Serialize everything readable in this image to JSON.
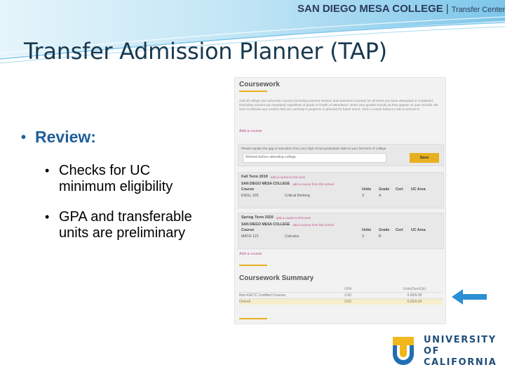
{
  "header": {
    "brand_school": "SAN DIEGO MESA COLLEGE",
    "brand_center": "Transfer Center"
  },
  "slide": {
    "title": "Transfer Admission Planner (TAP)",
    "bullet_main": "Review:",
    "sub_bullets": [
      "Checks for UC minimum eligibility",
      "GPA and transferable units are preliminary"
    ]
  },
  "panel": {
    "coursework_title": "Coursework",
    "intro_text": "Add all college and university courses (including summer session and extension courses) for all terms you have attempted or completed (including courses you repeated) regardless of grade or length of attendance. Enter your grades exactly as they appear on your records. Be sure to indicate any courses that are currently in progress or planned for future terms. Click a course below to edit or remove it.",
    "add_course_link": "Add a course",
    "gap_prompt": "Please explain the gap in education from your high school graduation date to your first term of college.",
    "gap_answer": "Worked before attending college",
    "save_label": "Save",
    "terms": [
      {
        "name": "Fall Term 2019",
        "add_link": "add a course to this term",
        "school": "SAN DIEGO MESA COLLEGE",
        "school_link": "add a course from this school",
        "headers": [
          "Course",
          "",
          "Units",
          "Grade",
          "Cert",
          "UC Area"
        ],
        "rows": [
          [
            "ENGL 205",
            "Critical thinking",
            "3",
            "A",
            "",
            ""
          ]
        ]
      },
      {
        "name": "Spring Term 2020",
        "add_link": "add a course to this term",
        "school": "SAN DIEGO MESA COLLEGE",
        "school_link": "add a course from this school",
        "headers": [
          "Course",
          "",
          "Units",
          "Grade",
          "Cert",
          "UC Area"
        ],
        "rows": [
          [
            "MATH 121",
            "Calculus",
            "3",
            "B",
            "",
            ""
          ]
        ]
      }
    ],
    "add_course_link_2": "Add a course",
    "summary_title": "Coursework Summary",
    "summary_headers": [
      "",
      "GPA",
      "Units(Sem/Qtr)"
    ],
    "summary_rows": [
      [
        "Non-IGETC Certified Courses",
        "3.50",
        "6.00/9.00"
      ],
      [
        "Overall",
        "3.50",
        "6.00/9.00"
      ]
    ]
  },
  "logo": {
    "line1": "UNIVERSITY",
    "line2": "OF",
    "line3": "CALIFORNIA"
  },
  "colors": {
    "title": "#17394f",
    "bullet_main": "#1f5f9a",
    "accent_gold": "#e8b020",
    "arrow_blue": "#2b8fd6",
    "swoosh_blue": "#5fb6e6"
  }
}
